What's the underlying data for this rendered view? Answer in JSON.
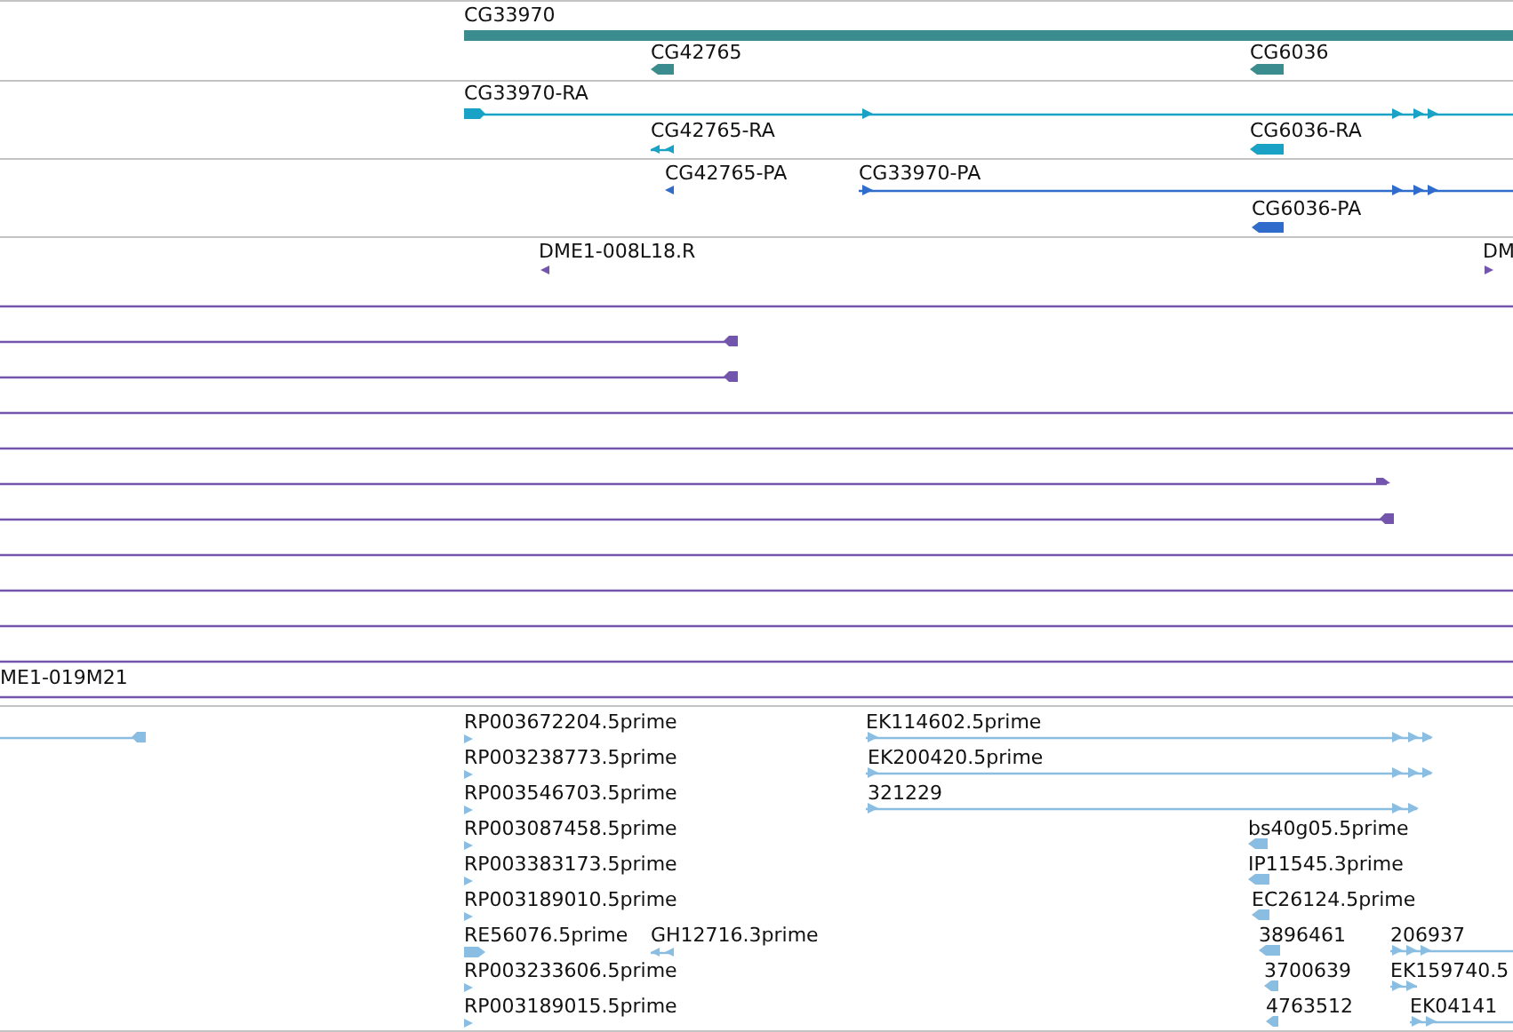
{
  "tracks": [
    {
      "color": "#3a8c8e",
      "features": [
        {
          "label": "CG33970",
          "kind": "bar"
        },
        {
          "label": "CG42765",
          "kind": "block",
          "reverse": true
        },
        {
          "label": "CG6036",
          "kind": "block",
          "reverse": true
        }
      ]
    },
    {
      "color": "#1aa2c6",
      "features": [
        {
          "label": "CG33970-RA",
          "kind": "line",
          "reverse": false
        },
        {
          "label": "CG42765-RA",
          "kind": "arrow",
          "reverse": true
        },
        {
          "label": "CG6036-RA",
          "kind": "block",
          "reverse": true
        }
      ]
    },
    {
      "color": "#2f6ccc",
      "features": [
        {
          "label": "CG42765-PA",
          "kind": "arrow",
          "reverse": true
        },
        {
          "label": "CG33970-PA",
          "kind": "line",
          "reverse": false
        },
        {
          "label": "CG6036-PA",
          "kind": "block",
          "reverse": true
        }
      ]
    },
    {
      "color": "#7355ad",
      "features": [
        {
          "label": "DME1-008L18.R",
          "kind": "arrow",
          "reverse": true
        },
        {
          "label": "DM",
          "kind": "arrow",
          "reverse": false
        },
        {
          "kind": "span"
        },
        {
          "kind": "end",
          "reverse": true
        },
        {
          "kind": "end",
          "reverse": true
        },
        {
          "kind": "span"
        },
        {
          "kind": "span"
        },
        {
          "kind": "end",
          "reverse": false
        },
        {
          "kind": "end",
          "reverse": true
        },
        {
          "kind": "span"
        },
        {
          "kind": "span"
        },
        {
          "kind": "span"
        },
        {
          "kind": "span"
        },
        {
          "label": "ME1-019M21",
          "kind": "span"
        }
      ]
    },
    {
      "color": "#8abde2",
      "features": [
        {
          "kind": "end",
          "reverse": true
        },
        {
          "label": "RP003672204.5prime",
          "kind": "arrow",
          "reverse": false
        },
        {
          "label": "RP003238773.5prime",
          "kind": "arrow",
          "reverse": false
        },
        {
          "label": "RP003546703.5prime",
          "kind": "arrow",
          "reverse": false
        },
        {
          "label": "RP003087458.5prime",
          "kind": "arrow",
          "reverse": false
        },
        {
          "label": "RP003383173.5prime",
          "kind": "arrow",
          "reverse": false
        },
        {
          "label": "RP003189010.5prime",
          "kind": "arrow",
          "reverse": false
        },
        {
          "label": "RE56076.5prime",
          "kind": "block",
          "reverse": false
        },
        {
          "label": "RP003233606.5prime",
          "kind": "arrow",
          "reverse": false
        },
        {
          "label": "RP003189015.5prime",
          "kind": "arrow",
          "reverse": false
        },
        {
          "label": "GH12716.3prime",
          "kind": "arrow",
          "reverse": true
        },
        {
          "label": "EK114602.5prime",
          "kind": "line",
          "reverse": false
        },
        {
          "label": "EK200420.5prime",
          "kind": "line",
          "reverse": false
        },
        {
          "label": "321229",
          "kind": "line",
          "reverse": false
        },
        {
          "label": "bs40g05.5prime",
          "kind": "block",
          "reverse": true
        },
        {
          "label": "IP11545.3prime",
          "kind": "block",
          "reverse": true
        },
        {
          "label": "EC26124.5prime",
          "kind": "block",
          "reverse": true
        },
        {
          "label": "3896461",
          "kind": "block",
          "reverse": true
        },
        {
          "label": "3700639",
          "kind": "block",
          "reverse": true
        },
        {
          "label": "4763512",
          "kind": "block",
          "reverse": true
        },
        {
          "label": "206937",
          "kind": "line",
          "reverse": false
        },
        {
          "label": "EK159740.5",
          "kind": "line",
          "reverse": false
        },
        {
          "label": "EK04141",
          "kind": "line",
          "reverse": false
        }
      ]
    }
  ]
}
